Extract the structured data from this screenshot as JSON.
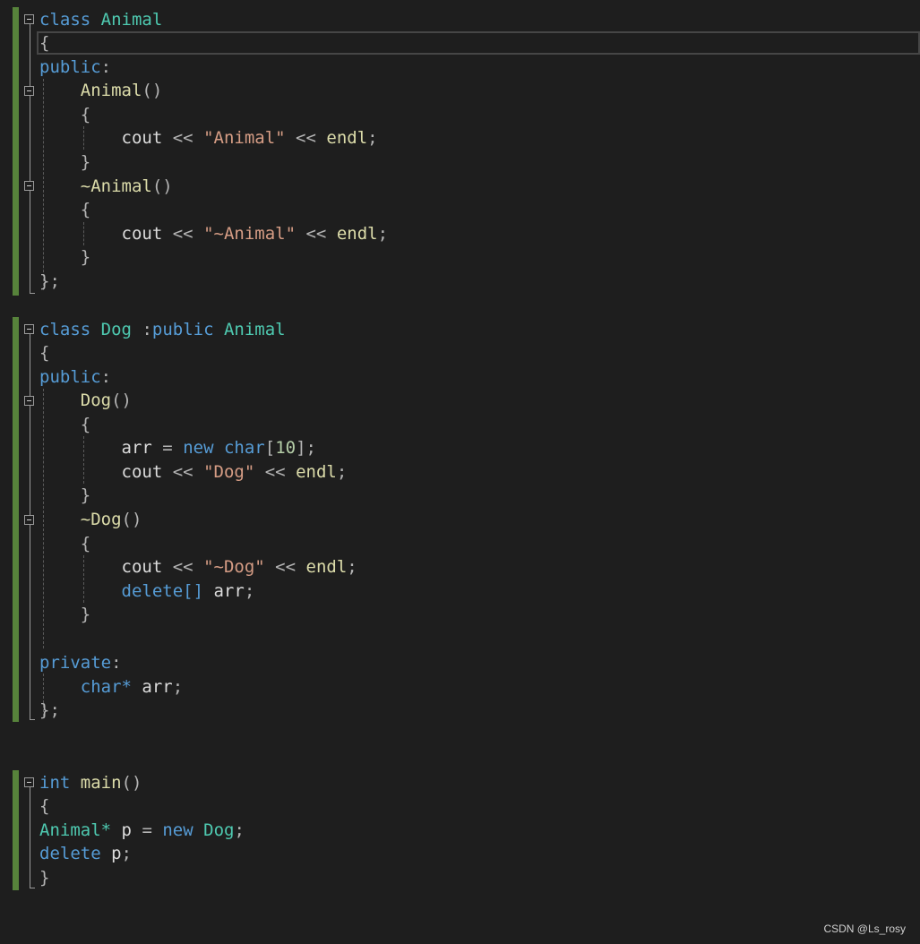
{
  "editor": {
    "lines": {
      "l1": {
        "kw": "class",
        "ty": "Animal"
      },
      "l2": {
        "pu": "{"
      },
      "l3": {
        "kw": "public",
        "pu": ":"
      },
      "l4": {
        "fn": "Animal",
        "pu": "()"
      },
      "l5": {
        "pu": "{"
      },
      "l6": {
        "id1": "cout",
        "op1": "<<",
        "str": "\"Animal\"",
        "op2": "<<",
        "id2": "endl",
        "pu": ";"
      },
      "l7": {
        "pu": "}"
      },
      "l8": {
        "fn": "~Animal",
        "pu": "()"
      },
      "l9": {
        "pu": "{"
      },
      "l10": {
        "id1": "cout",
        "op1": "<<",
        "str": "\"~Animal\"",
        "op2": "<<",
        "id2": "endl",
        "pu": ";"
      },
      "l11": {
        "pu": "}"
      },
      "l12": {
        "pu": "};"
      },
      "l13": {
        "kw": "class",
        "ty": "Dog",
        "pu": ":",
        "kw2": "public",
        "ty2": "Animal"
      },
      "l14": {
        "pu": "{"
      },
      "l15": {
        "kw": "public",
        "pu": ":"
      },
      "l16": {
        "fn": "Dog",
        "pu": "()"
      },
      "l17": {
        "pu": "{"
      },
      "l18": {
        "id": "arr",
        "op": "=",
        "kw": "new",
        "kw2": "char",
        "pu1": "[",
        "num": "10",
        "pu2": "];"
      },
      "l19": {
        "id1": "cout",
        "op1": "<<",
        "str": "\"Dog\"",
        "op2": "<<",
        "id2": "endl",
        "pu": ";"
      },
      "l20": {
        "pu": "}"
      },
      "l21": {
        "fn": "~Dog",
        "pu": "()"
      },
      "l22": {
        "pu": "{"
      },
      "l23": {
        "id1": "cout",
        "op1": "<<",
        "str": "\"~Dog\"",
        "op2": "<<",
        "id2": "endl",
        "pu": ";"
      },
      "l24": {
        "kw": "delete[]",
        "id": "arr",
        "pu": ";"
      },
      "l25": {
        "pu": "}"
      },
      "l26": {
        "kw": "private",
        "pu": ":"
      },
      "l27": {
        "kw": "char*",
        "id": "arr",
        "pu": ";"
      },
      "l28": {
        "pu": "};"
      },
      "l29": {
        "kw": "int",
        "fn": "main",
        "pu": "()"
      },
      "l30": {
        "pu": "{"
      },
      "l31": {
        "ty": "Animal*",
        "id": "p",
        "op": "=",
        "kw": "new",
        "ty2": "Dog",
        "pu": ";"
      },
      "l32": {
        "kw": "delete",
        "id": "p",
        "pu": ";"
      },
      "l33": {
        "pu": "}"
      }
    }
  },
  "watermark": "CSDN @Ls_rosy",
  "colors": {
    "background": "#1e1e1e",
    "keyword": "#569cd6",
    "type": "#4ec9b0",
    "function": "#dcdcaa",
    "string": "#d69d85",
    "identifier": "#dcdcdc",
    "number": "#b5cea8",
    "change_bar": "#57833b"
  }
}
